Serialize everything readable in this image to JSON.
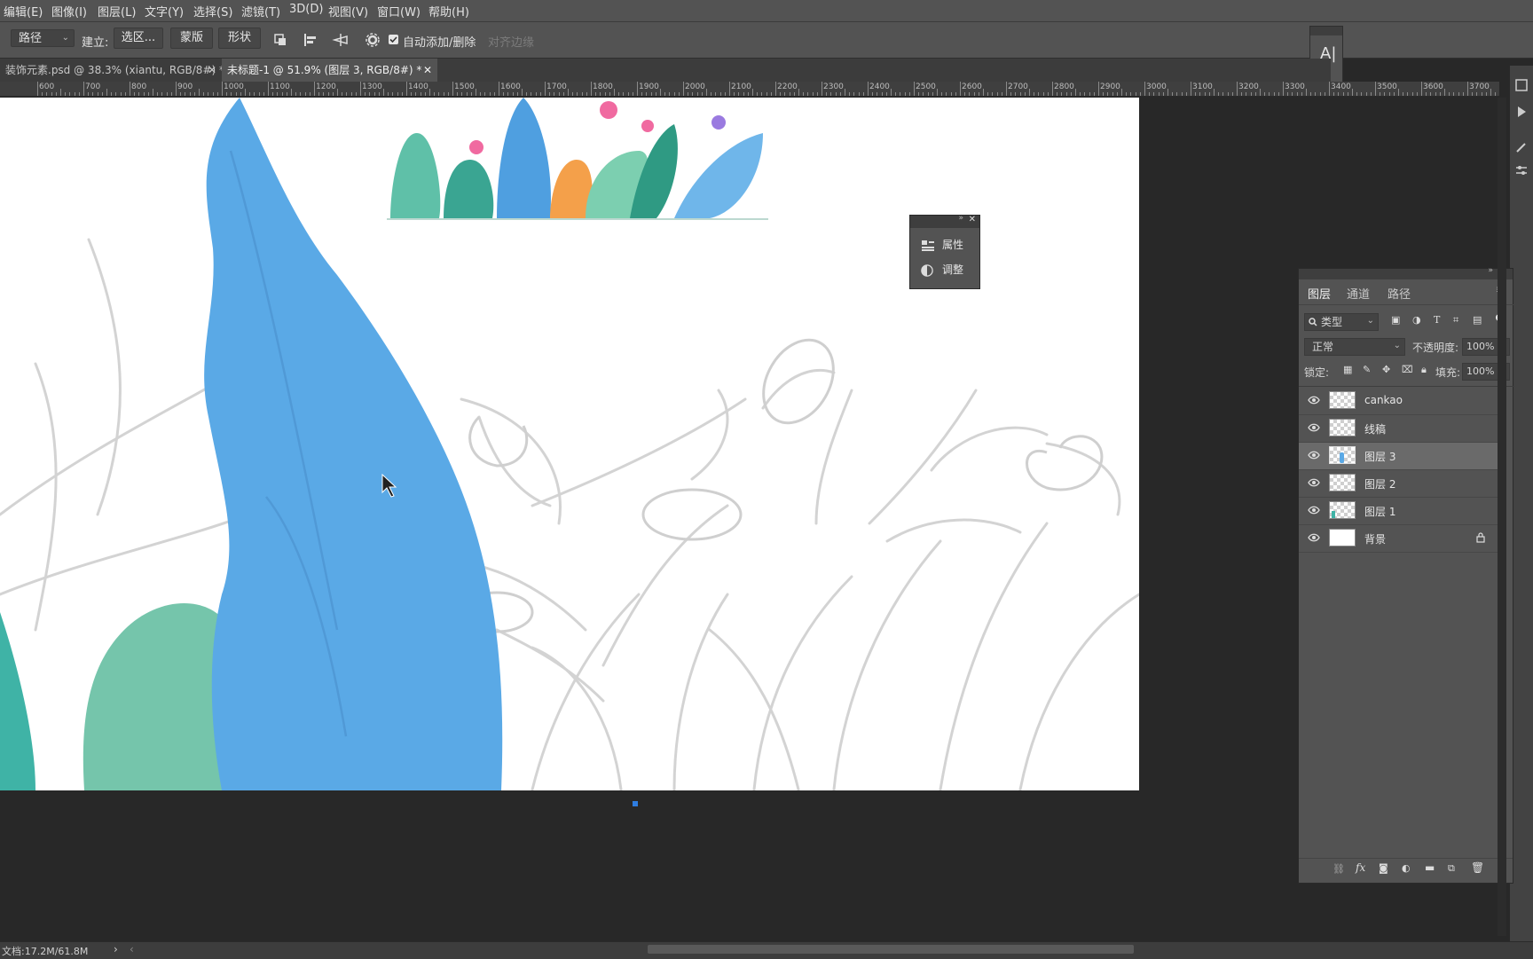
{
  "menu": [
    "编辑(E)",
    "图像(I)",
    "图层(L)",
    "文字(Y)",
    "选择(S)",
    "滤镜(T)",
    "3D(D)",
    "视图(V)",
    "窗口(W)",
    "帮助(H)"
  ],
  "options": {
    "tool_mode": "路径",
    "make_label": "建立:",
    "selection_btn": "选区...",
    "mask_btn": "蒙版",
    "shape_btn": "形状",
    "auto_add_delete": "自动添加/删除",
    "align_edges": "对齐边缘",
    "auto_add_checked": true
  },
  "tabs": [
    {
      "title": "装饰元素.psd @ 38.3% (xiantu, RGB/8#) *",
      "active": false
    },
    {
      "title": "未标题-1 @ 51.9% (图层 3, RGB/8#) *",
      "active": true
    }
  ],
  "ruler": [
    "600",
    "700",
    "800",
    "900",
    "1000",
    "1100",
    "1200",
    "1300",
    "1400",
    "1500",
    "1600",
    "1700",
    "1800",
    "1900",
    "2000",
    "2100",
    "2200",
    "2300",
    "2400",
    "2500",
    "2600",
    "2700",
    "2800",
    "2900",
    "3000",
    "3100",
    "3200",
    "3300",
    "3400",
    "3500",
    "3600",
    "3700"
  ],
  "mini_panel": {
    "properties": "属性",
    "adjustments": "调整"
  },
  "char_panel": {
    "char_icon": "A|",
    "para_icon": "¶"
  },
  "layers_panel": {
    "tabs": [
      "图层",
      "通道",
      "路径"
    ],
    "active_tab": "图层",
    "filter_kind": "类型",
    "blend_mode": "正常",
    "opacity_label": "不透明度:",
    "opacity_value": "100%",
    "lock_label": "锁定:",
    "fill_label": "填充:",
    "fill_value": "100%",
    "layers": [
      {
        "name": "cankao",
        "visible": true,
        "selected": false,
        "locked": false
      },
      {
        "name": "线稿",
        "visible": true,
        "selected": false,
        "locked": false
      },
      {
        "name": "图层 3",
        "visible": true,
        "selected": true,
        "locked": false
      },
      {
        "name": "图层 2",
        "visible": true,
        "selected": false,
        "locked": false
      },
      {
        "name": "图层 1",
        "visible": true,
        "selected": false,
        "locked": false
      },
      {
        "name": "背景",
        "visible": true,
        "selected": false,
        "locked": true
      }
    ]
  },
  "status": {
    "doc_size": "文档:17.2M/61.8M"
  },
  "colors": {
    "accent_blue": "#5aa9e6",
    "teal": "#6ec2a6",
    "panel_bg": "#535353",
    "canvas_bg": "#ffffff"
  }
}
